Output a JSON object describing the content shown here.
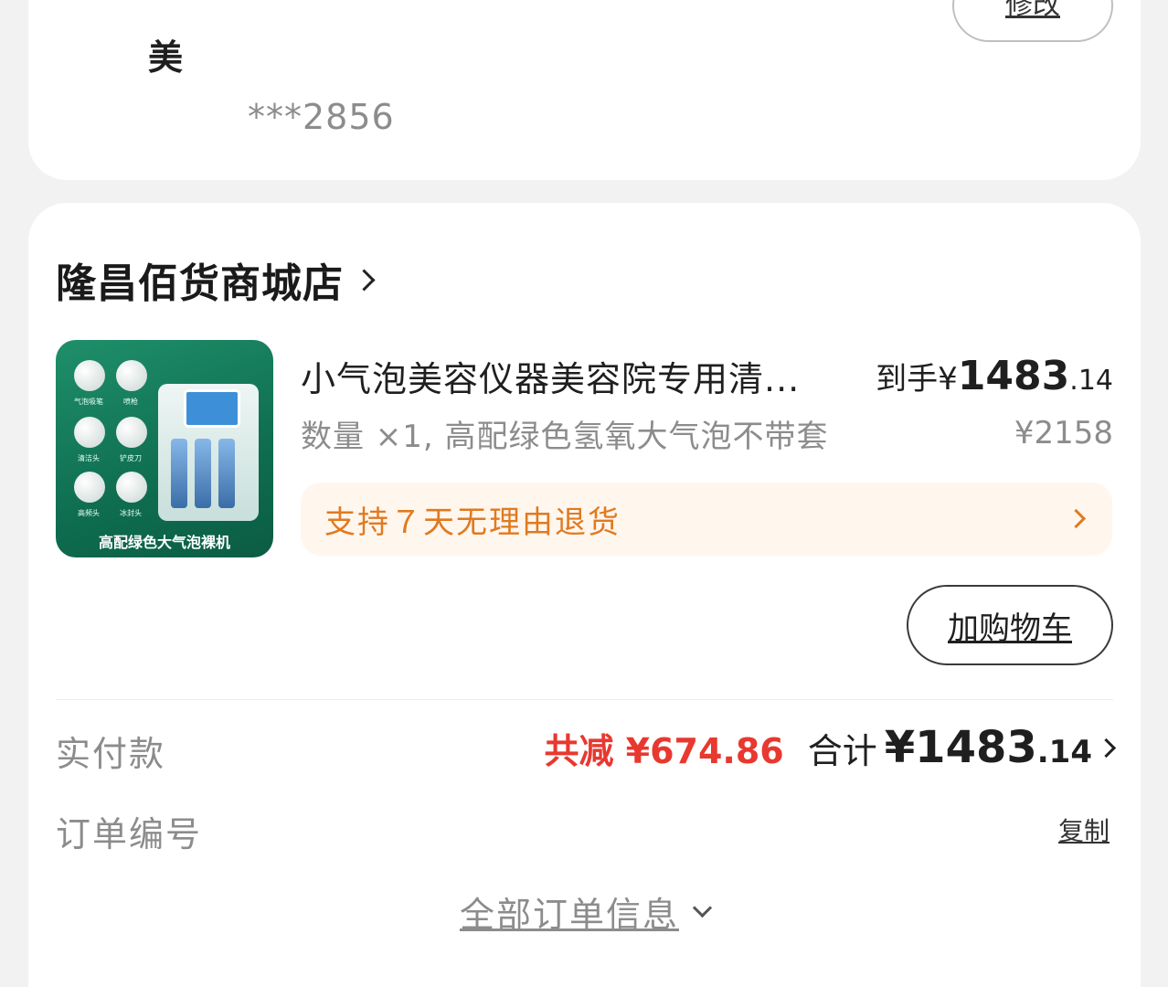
{
  "address": {
    "line1": "",
    "line2": "美",
    "phone": "***2856",
    "edit_label": "修改"
  },
  "shop": {
    "name": "隆昌佰货商城店"
  },
  "product": {
    "image_caption": "高配绿色大气泡裸机",
    "image_tool_labels": [
      "气泡吸笔",
      "喷枪",
      "清洁头",
      "铲皮刀",
      "高频头",
      "冰封头"
    ],
    "title": "小气泡美容仪器美容院专用清...",
    "price_prefix": "到手",
    "price_currency": "¥",
    "price_integer": "1483",
    "price_decimal": ".14",
    "sku": "数量 ×1, 高配绿色氢氧大气泡不带套",
    "original_price": "¥2158"
  },
  "return_policy": {
    "label": "支持７天无理由退货"
  },
  "cart_button": {
    "label": "加购物车"
  },
  "payment": {
    "label": "实付款",
    "discount": "共减 ¥674.86",
    "total_label": "合计",
    "total_currency": "¥",
    "total_integer": "1483",
    "total_decimal": ".14"
  },
  "order": {
    "label": "订单编号",
    "copy_label": "复制"
  },
  "all_info": {
    "label": "全部订单信息"
  }
}
